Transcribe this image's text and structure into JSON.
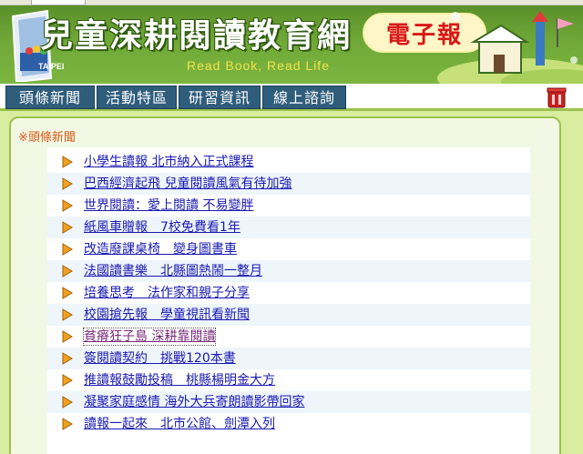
{
  "header": {
    "site_title": "兒童深耕閱讀教育網",
    "slogan": "Read Book, Read Life",
    "logo_text": "TAIPEI",
    "epaper_label": "電子報"
  },
  "nav": {
    "items": [
      {
        "label": "頭條新聞"
      },
      {
        "label": "活動特區"
      },
      {
        "label": "研習資訊"
      },
      {
        "label": "線上諮詢"
      }
    ]
  },
  "colors": {
    "banner_green": "#6fa837",
    "nav_blue": "#2f5d7c",
    "link_blue": "#1a1ab0",
    "section_orange": "#d85a1a",
    "epaper_red": "#d81818"
  },
  "headlines": {
    "section_title": "※頭條新聞",
    "items": [
      {
        "title": "小學生讀報 北市納入正式課程"
      },
      {
        "title": "巴西經濟起飛 兒童閱讀風氣有待加強"
      },
      {
        "title": "世界閱讀：愛上閱讀 不易變胖"
      },
      {
        "title": "紙風車贈報　7校免費看1年"
      },
      {
        "title": "改造廢課桌椅　變身圖書車"
      },
      {
        "title": "法國讀書樂　北縣圖熱鬧一整月"
      },
      {
        "title": "培養思考　法作家和親子分享"
      },
      {
        "title": "校園搶先報　學童視訊看新聞"
      },
      {
        "title": "貧瘠狂子島 深耕靠閱讀"
      },
      {
        "title": "簽閱讀契約　挑戰120本書"
      },
      {
        "title": "推讀報鼓勵投稿　桃縣楊明金大方"
      },
      {
        "title": "凝聚家庭感情 海外大兵寄朗讀影帶回家"
      },
      {
        "title": "讀報一起來　北市公館、劍潭入列"
      }
    ]
  }
}
